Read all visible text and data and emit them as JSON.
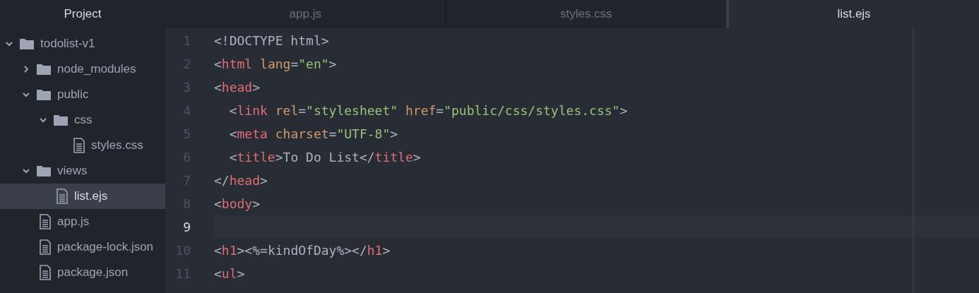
{
  "sidebar": {
    "title": "Project",
    "tree": [
      {
        "label": "todolist-v1",
        "kind": "folder",
        "expanded": true,
        "selected": false,
        "children": [
          {
            "label": "node_modules",
            "kind": "folder",
            "expanded": false,
            "selected": false
          },
          {
            "label": "public",
            "kind": "folder",
            "expanded": true,
            "selected": false,
            "children": [
              {
                "label": "css",
                "kind": "folder",
                "expanded": true,
                "selected": false,
                "children": [
                  {
                    "label": "styles.css",
                    "kind": "file",
                    "selected": false
                  }
                ]
              }
            ]
          },
          {
            "label": "views",
            "kind": "folder",
            "expanded": true,
            "selected": false,
            "children": [
              {
                "label": "list.ejs",
                "kind": "file",
                "selected": true
              }
            ]
          },
          {
            "label": "app.js",
            "kind": "file",
            "selected": false
          },
          {
            "label": "package-lock.json",
            "kind": "file",
            "selected": false
          },
          {
            "label": "package.json",
            "kind": "file",
            "selected": false
          }
        ]
      }
    ]
  },
  "tabs": [
    {
      "label": "app.js",
      "selected": false
    },
    {
      "label": "styles.css",
      "selected": false
    },
    {
      "label": "list.ejs",
      "selected": true
    }
  ],
  "editor": {
    "lines": [
      {
        "number": "1",
        "cursor": false,
        "tokens": [
          {
            "kind": "punct",
            "text": "<!DOCTYPE html>"
          }
        ]
      },
      {
        "number": "2",
        "cursor": false,
        "tokens": [
          {
            "kind": "punct",
            "text": "<"
          },
          {
            "kind": "tag",
            "text": "html"
          },
          {
            "kind": "attr",
            "text": " lang"
          },
          {
            "kind": "punct",
            "text": "="
          },
          {
            "kind": "string",
            "text": "\"en\""
          },
          {
            "kind": "punct",
            "text": ">"
          }
        ]
      },
      {
        "number": "3",
        "cursor": false,
        "tokens": [
          {
            "kind": "punct",
            "text": "<"
          },
          {
            "kind": "tag",
            "text": "head"
          },
          {
            "kind": "punct",
            "text": ">"
          }
        ]
      },
      {
        "number": "4",
        "cursor": false,
        "tokens": [
          {
            "kind": "punct",
            "text": "  <"
          },
          {
            "kind": "tag",
            "text": "link"
          },
          {
            "kind": "attr",
            "text": " rel"
          },
          {
            "kind": "punct",
            "text": "="
          },
          {
            "kind": "string",
            "text": "\"stylesheet\""
          },
          {
            "kind": "attr",
            "text": " href"
          },
          {
            "kind": "punct",
            "text": "="
          },
          {
            "kind": "string",
            "text": "\"public/css/styles.css\""
          },
          {
            "kind": "punct",
            "text": ">"
          }
        ]
      },
      {
        "number": "5",
        "cursor": false,
        "tokens": [
          {
            "kind": "punct",
            "text": "  <"
          },
          {
            "kind": "tag",
            "text": "meta"
          },
          {
            "kind": "attr",
            "text": " charset"
          },
          {
            "kind": "punct",
            "text": "="
          },
          {
            "kind": "string",
            "text": "\"UTF-8\""
          },
          {
            "kind": "punct",
            "text": ">"
          }
        ]
      },
      {
        "number": "6",
        "cursor": false,
        "tokens": [
          {
            "kind": "punct",
            "text": "  <"
          },
          {
            "kind": "tag",
            "text": "title"
          },
          {
            "kind": "punct",
            "text": ">To Do List</"
          },
          {
            "kind": "tag",
            "text": "title"
          },
          {
            "kind": "punct",
            "text": ">"
          }
        ]
      },
      {
        "number": "7",
        "cursor": false,
        "tokens": [
          {
            "kind": "punct",
            "text": "</"
          },
          {
            "kind": "tag",
            "text": "head"
          },
          {
            "kind": "punct",
            "text": ">"
          }
        ]
      },
      {
        "number": "8",
        "cursor": false,
        "tokens": [
          {
            "kind": "punct",
            "text": "<"
          },
          {
            "kind": "tag",
            "text": "body"
          },
          {
            "kind": "punct",
            "text": ">"
          }
        ]
      },
      {
        "number": "9",
        "cursor": true
      },
      {
        "number": "10",
        "cursor": false,
        "tokens": [
          {
            "kind": "punct",
            "text": "<"
          },
          {
            "kind": "tag",
            "text": "h1"
          },
          {
            "kind": "punct",
            "text": "><%=kindOfDay%></"
          },
          {
            "kind": "tag",
            "text": "h1"
          },
          {
            "kind": "punct",
            "text": ">"
          }
        ]
      },
      {
        "number": "11",
        "cursor": false,
        "tokens": [
          {
            "kind": "punct",
            "text": "<"
          },
          {
            "kind": "tag",
            "text": "ul"
          },
          {
            "kind": "punct",
            "text": ">"
          }
        ]
      }
    ]
  }
}
